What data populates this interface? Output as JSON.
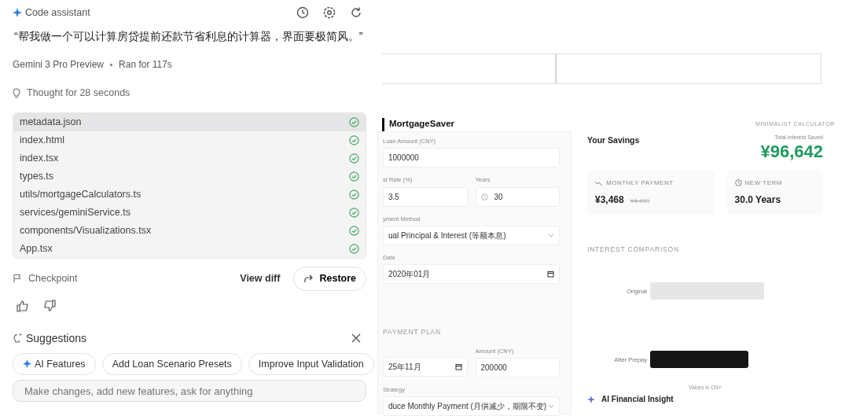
{
  "assistant": {
    "title": "Code assistant",
    "prompt": "“帮我做一个可以计算房贷提前还款节省利息的计算器，界面要极简风。”",
    "model": "Gemini 3 Pro Preview",
    "run_time": "Ran for 117s",
    "thought": "Thought for 28 seconds",
    "files": [
      {
        "name": "metadata.json",
        "done": true,
        "selected": true
      },
      {
        "name": "index.html",
        "done": true,
        "selected": false
      },
      {
        "name": "index.tsx",
        "done": true,
        "selected": false
      },
      {
        "name": "types.ts",
        "done": true,
        "selected": false
      },
      {
        "name": "utils/mortgageCalculators.ts",
        "done": true,
        "selected": false
      },
      {
        "name": "services/geminiService.ts",
        "done": true,
        "selected": false
      },
      {
        "name": "components/Visualizations.tsx",
        "done": true,
        "selected": false
      },
      {
        "name": "App.tsx",
        "done": true,
        "selected": false
      }
    ],
    "checkpoint": "Checkpoint",
    "view_diff": "View diff",
    "restore": "Restore",
    "suggestions_title": "Suggestions",
    "suggestions": [
      {
        "label": "AI Features",
        "kind": "ai"
      },
      {
        "label": "Add Loan Scenario Presets",
        "kind": "plain"
      },
      {
        "label": "Improve Input Validation",
        "kind": "plain"
      }
    ],
    "input": {
      "placeholder": "Make changes, add new features, ask for anything"
    }
  },
  "preview": {
    "app_name": "MortgageSaver",
    "tagline": "MINIMALIST CALCULATOR",
    "loan_fields": [
      {
        "label": "Loan Amount (CNY)",
        "value": "1000000",
        "kind": "text"
      },
      {
        "label": "st Rate (%)",
        "value": "3.5",
        "kind": "text",
        "half": true
      },
      {
        "label": "Years",
        "value": "30",
        "kind": "clock",
        "half": true
      },
      {
        "label": "yment Method",
        "value": "ual Principal & Interest (等额本息)",
        "kind": "select"
      },
      {
        "label": "Date",
        "value": "2020年01月",
        "kind": "date"
      }
    ],
    "plan_title": "PAYMENT PLAN",
    "plan_fields": [
      {
        "value": "25年11月",
        "kind": "date",
        "half": true
      },
      {
        "label": "Amount (CNY)",
        "value": "200000",
        "kind": "text",
        "half": true
      },
      {
        "label": "Strategy",
        "value": "duce Monthly Payment (月供减少，期限不变)",
        "kind": "select"
      }
    ],
    "savings": {
      "title": "Your Savings",
      "total_label": "Total Interest Saved",
      "total": "¥96,642",
      "stats": [
        {
          "label": "MONTHLY PAYMENT",
          "value": "¥3,468",
          "old": "¥4,490",
          "kind": "trend"
        },
        {
          "label": "NEW TERM",
          "value": "30.0 Years",
          "kind": "clock"
        }
      ]
    },
    "comparison": {
      "title": "INTEREST COMPARISON",
      "bars": [
        {
          "label": "Original",
          "kind": "light"
        },
        {
          "label": "After Prepay",
          "kind": "dark"
        }
      ],
      "note": "Values in CNY"
    },
    "insight": "AI Financial Insight"
  }
}
